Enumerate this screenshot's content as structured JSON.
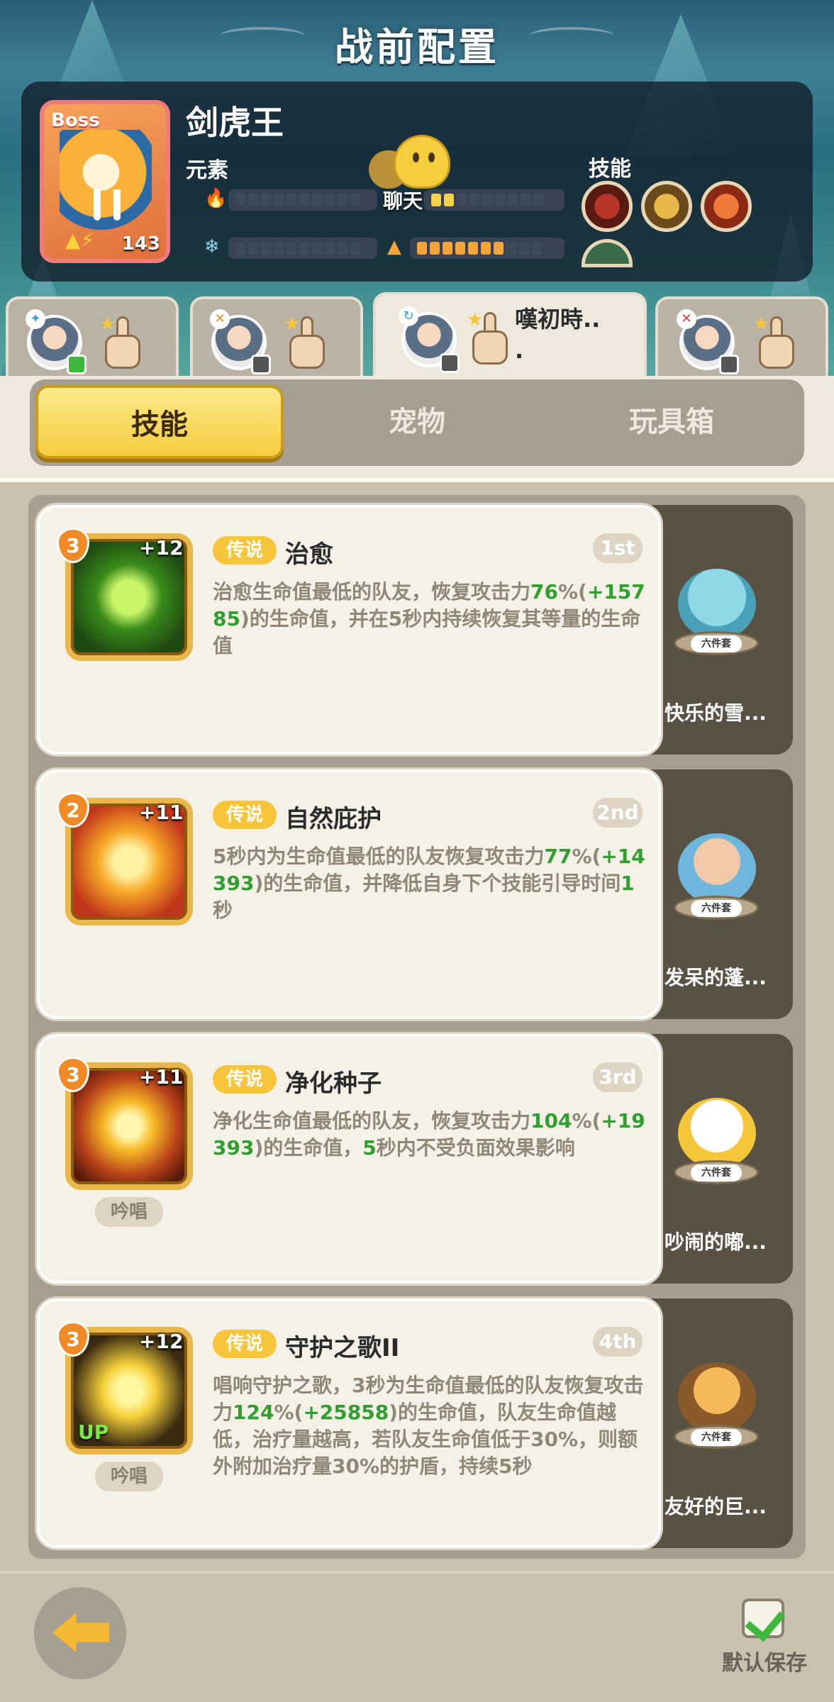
{
  "header": {
    "title": "战前配置"
  },
  "boss": {
    "tag": "Boss",
    "level": "143",
    "name": "剑虎王",
    "element_label": "元素",
    "skill_label": "技能"
  },
  "chat": {
    "label": "聊天"
  },
  "team_tabs": [
    {
      "name": ""
    },
    {
      "name": ""
    },
    {
      "name": "嘆初時..\n."
    },
    {
      "name": ""
    }
  ],
  "segments": [
    {
      "label": "技能"
    },
    {
      "label": "宠物"
    },
    {
      "label": "玩具箱"
    }
  ],
  "skills": [
    {
      "level": "3",
      "plus": "+12",
      "rarity": "传说",
      "name": "治愈",
      "order": "1st",
      "chant": "",
      "desc_parts": [
        "治愈生命值最低的队友，恢复攻击力",
        "76",
        "%(",
        "+15785",
        ")的生命值，并在5秒内持续恢复其等量的生命值"
      ],
      "pet_name": "快乐的雪...",
      "pet_set": "六件套"
    },
    {
      "level": "2",
      "plus": "+11",
      "rarity": "传说",
      "name": "自然庇护",
      "order": "2nd",
      "chant": "",
      "desc_parts": [
        "5秒内为生命值最低的队友恢复攻击力",
        "77",
        "%(",
        "+14393",
        ")的生命值，并降低自身下个技能引导时间",
        "1",
        "秒"
      ],
      "pet_name": "发呆的蓬...",
      "pet_set": "六件套"
    },
    {
      "level": "3",
      "plus": "+11",
      "rarity": "传说",
      "name": "净化种子",
      "order": "3rd",
      "chant": "吟唱",
      "desc_parts": [
        "净化生命值最低的队友，恢复攻击力",
        "104",
        "%(",
        "+19393",
        ")的生命值，",
        "5",
        "秒内不受负面效果影响"
      ],
      "pet_name": "吵闹的嘟...",
      "pet_set": "六件套"
    },
    {
      "level": "3",
      "plus": "+12",
      "rarity": "传说",
      "name": "守护之歌II",
      "order": "4th",
      "chant": "吟唱",
      "desc_parts": [
        "唱响守护之歌，3秒为生命值最低的队友恢复攻击力",
        "124",
        "%(",
        "+25858",
        ")的生命值，队友生命值越低，治疗量越高，若队友生命值低于30%，则额外附加治疗量30%的护盾，持续5秒"
      ],
      "pet_name": "友好的巨...",
      "pet_set": "六件套",
      "up": "UP"
    }
  ],
  "footer": {
    "save_label": "默认保存"
  },
  "colors": {
    "accent": "#f5cd3e",
    "highlight": "#2fa02f",
    "panel": "#f6f1e7"
  }
}
